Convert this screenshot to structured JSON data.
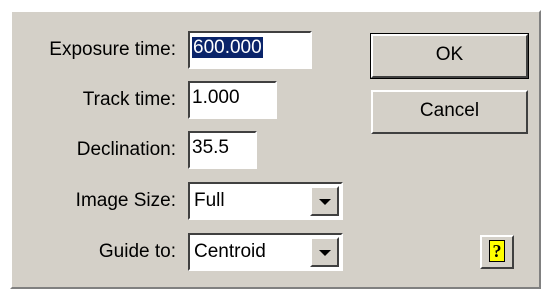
{
  "fields": {
    "exposure": {
      "label": "Exposure time:",
      "value": "600.000"
    },
    "track": {
      "label": "Track time:",
      "value": "1.000"
    },
    "declination": {
      "label": "Declination:",
      "value": "35.5"
    },
    "image_size": {
      "label": "Image Size:",
      "value": "Full"
    },
    "guide_to": {
      "label": "Guide to:",
      "value": "Centroid"
    }
  },
  "buttons": {
    "ok": "OK",
    "cancel": "Cancel",
    "help_icon": "?"
  },
  "colors": {
    "dialog_bg": "#d4d0c8",
    "selection_bg": "#0a246a",
    "help_bg": "#ffff00"
  },
  "icons": [
    "dropdown-arrow-icon",
    "help-question-icon"
  ]
}
